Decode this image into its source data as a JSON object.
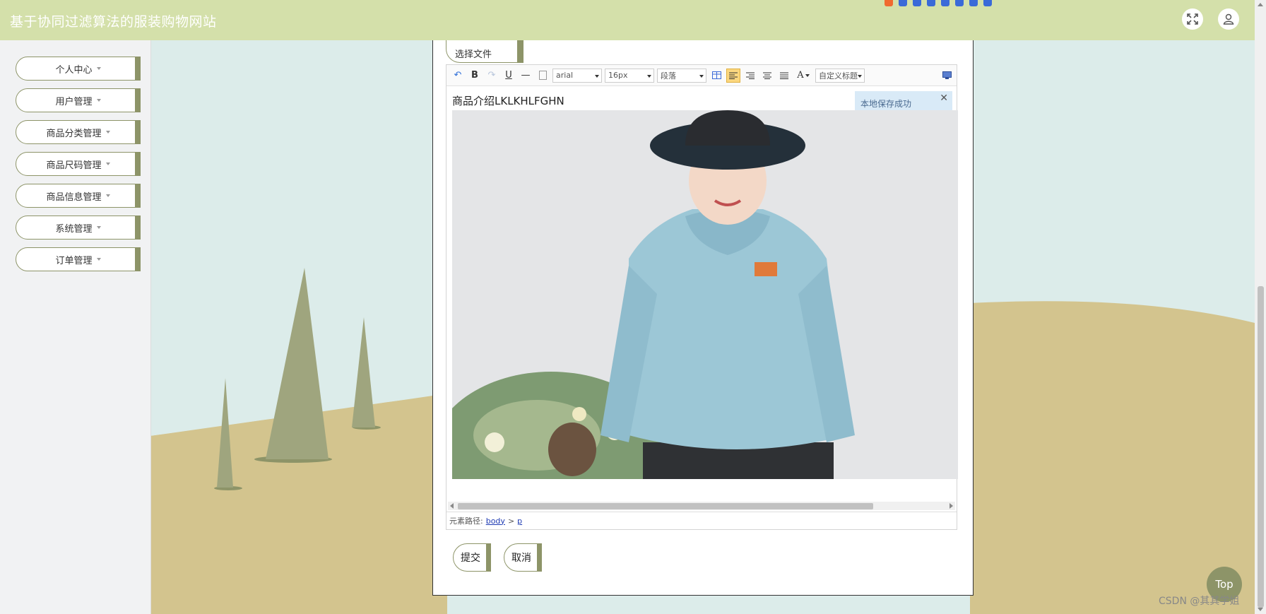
{
  "header": {
    "site_title": "基于协同过滤算法的服装购物网站",
    "background_color": "#d4e0aa"
  },
  "sidebar": {
    "items": [
      {
        "label": "个人中心"
      },
      {
        "label": "用户管理"
      },
      {
        "label": "商品分类管理"
      },
      {
        "label": "商品尺码管理"
      },
      {
        "label": "商品信息管理"
      },
      {
        "label": "系统管理"
      },
      {
        "label": "订单管理"
      }
    ]
  },
  "form": {
    "file_button_label": "选择文件",
    "editor": {
      "font_family": "arial",
      "font_size": "16px",
      "paragraph": "段落",
      "custom_heading": "自定义标题",
      "content_text": "商品介绍LKLKHLFGHN",
      "toast_message": "本地保存成功",
      "element_path_label": "元素路径:",
      "element_path": [
        "body",
        "p"
      ],
      "path_separator": ">"
    },
    "submit_label": "提交",
    "cancel_label": "取消"
  },
  "top_button_label": "Top",
  "watermark": "CSDN @其其学姐",
  "colors": {
    "accent": "#8d9468",
    "hill": "#d3c48e",
    "sky": "#dcecea"
  }
}
